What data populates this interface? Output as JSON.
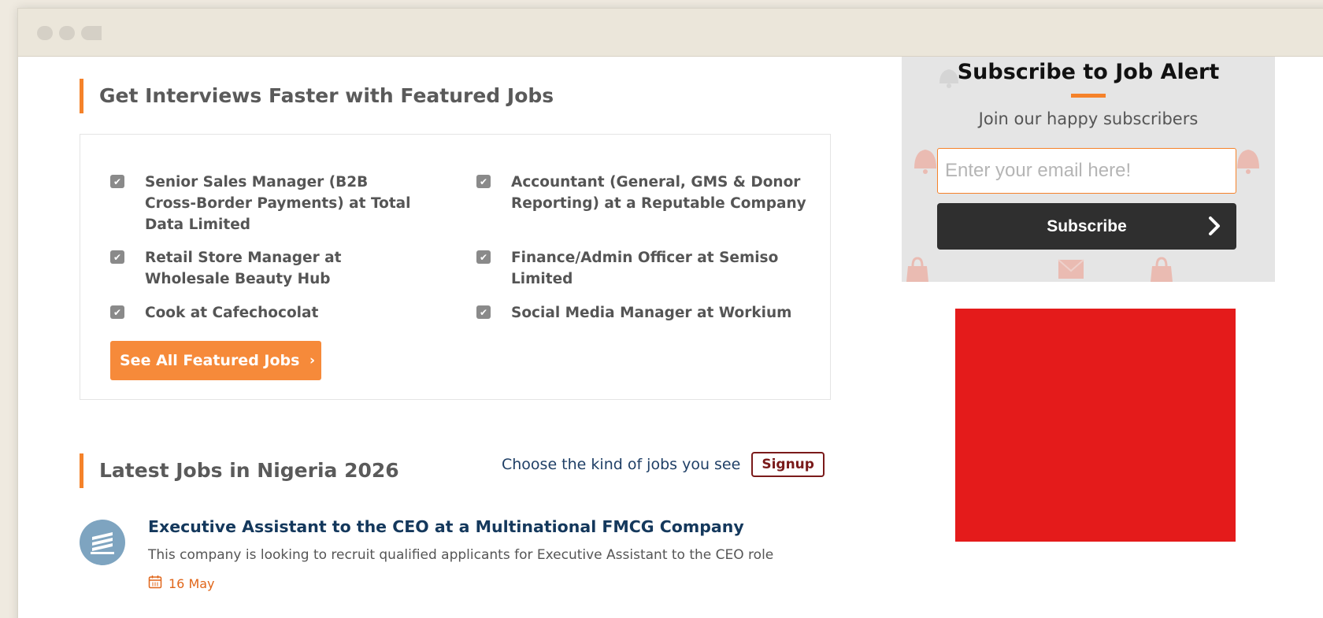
{
  "featured": {
    "title": "Get Interviews Faster with Featured Jobs",
    "jobs": [
      {
        "label": "Senior Sales Manager (B2B Cross-Border Payments) at Total Data Limited"
      },
      {
        "label": "Accountant (General, GMS & Donor Reporting) at a Reputable Company"
      },
      {
        "label": "Retail Store Manager at Wholesale Beauty Hub"
      },
      {
        "label": "Finance/Admin Officer at Semiso Limited"
      },
      {
        "label": "Cook at Cafechocolat"
      },
      {
        "label": "Social Media Manager at Workium"
      }
    ],
    "see_all_label": "See All Featured Jobs"
  },
  "latest": {
    "title": "Latest Jobs in Nigeria 2026",
    "choose_text": "Choose the kind of jobs you see",
    "signup_label": "Signup",
    "listings": [
      {
        "title": "Executive Assistant to the CEO at a Multinational FMCG Company",
        "description": "This company is looking to recruit qualified applicants for Executive Assistant to the CEO role",
        "date": "16 May"
      }
    ]
  },
  "subscribe": {
    "title": "Subscribe to Job Alert",
    "tagline": "Join our happy subscribers",
    "email_placeholder": "Enter your email here!",
    "button_label": "Subscribe"
  },
  "icons": {
    "check": "checkbox-checked-icon",
    "chevron": "chevron-right-icon",
    "calendar": "calendar-icon",
    "company": "building-icon"
  },
  "colors": {
    "accent": "#f5822a",
    "button_orange": "#f68a3a",
    "link_blue": "#14385c",
    "signup_maroon": "#7a1a1a",
    "dark_button": "#2f2f2f",
    "ad_red": "#e41b1b"
  }
}
